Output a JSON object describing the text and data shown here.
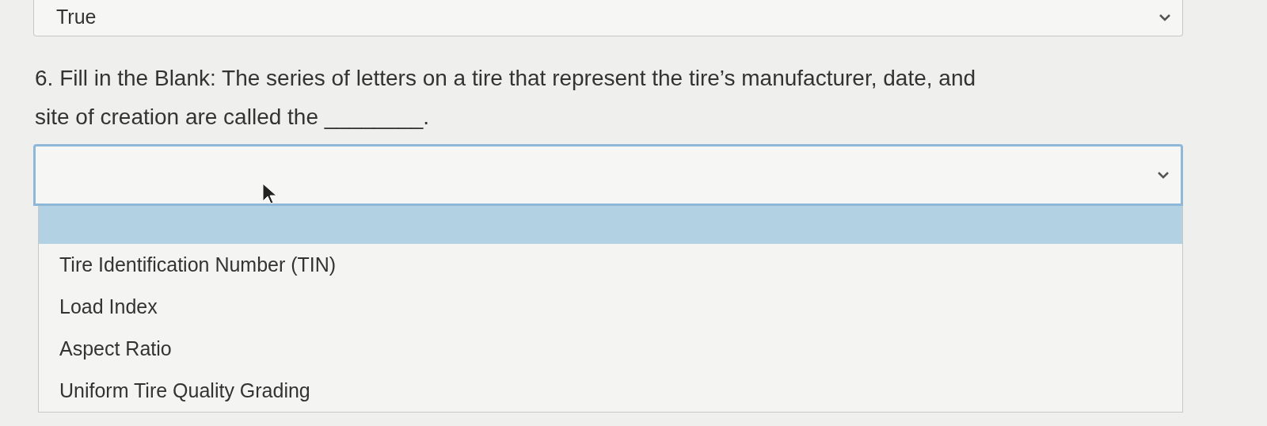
{
  "previous_answer": {
    "value": "True",
    "expanded": false
  },
  "question": {
    "text": "6. Fill in the Blank: The series of letters on a tire that represent the tire’s manufacturer, date, and site of creation are called the ________."
  },
  "answer_select": {
    "expanded": true,
    "blank_option": {
      "selected": true
    },
    "options": [
      {
        "label": "Tire Identification Number (TIN)",
        "selected": false
      },
      {
        "label": "Load Index",
        "selected": false
      },
      {
        "label": "Aspect Ratio",
        "selected": false
      },
      {
        "label": "Uniform Tire Quality Grading",
        "selected": false
      }
    ]
  }
}
